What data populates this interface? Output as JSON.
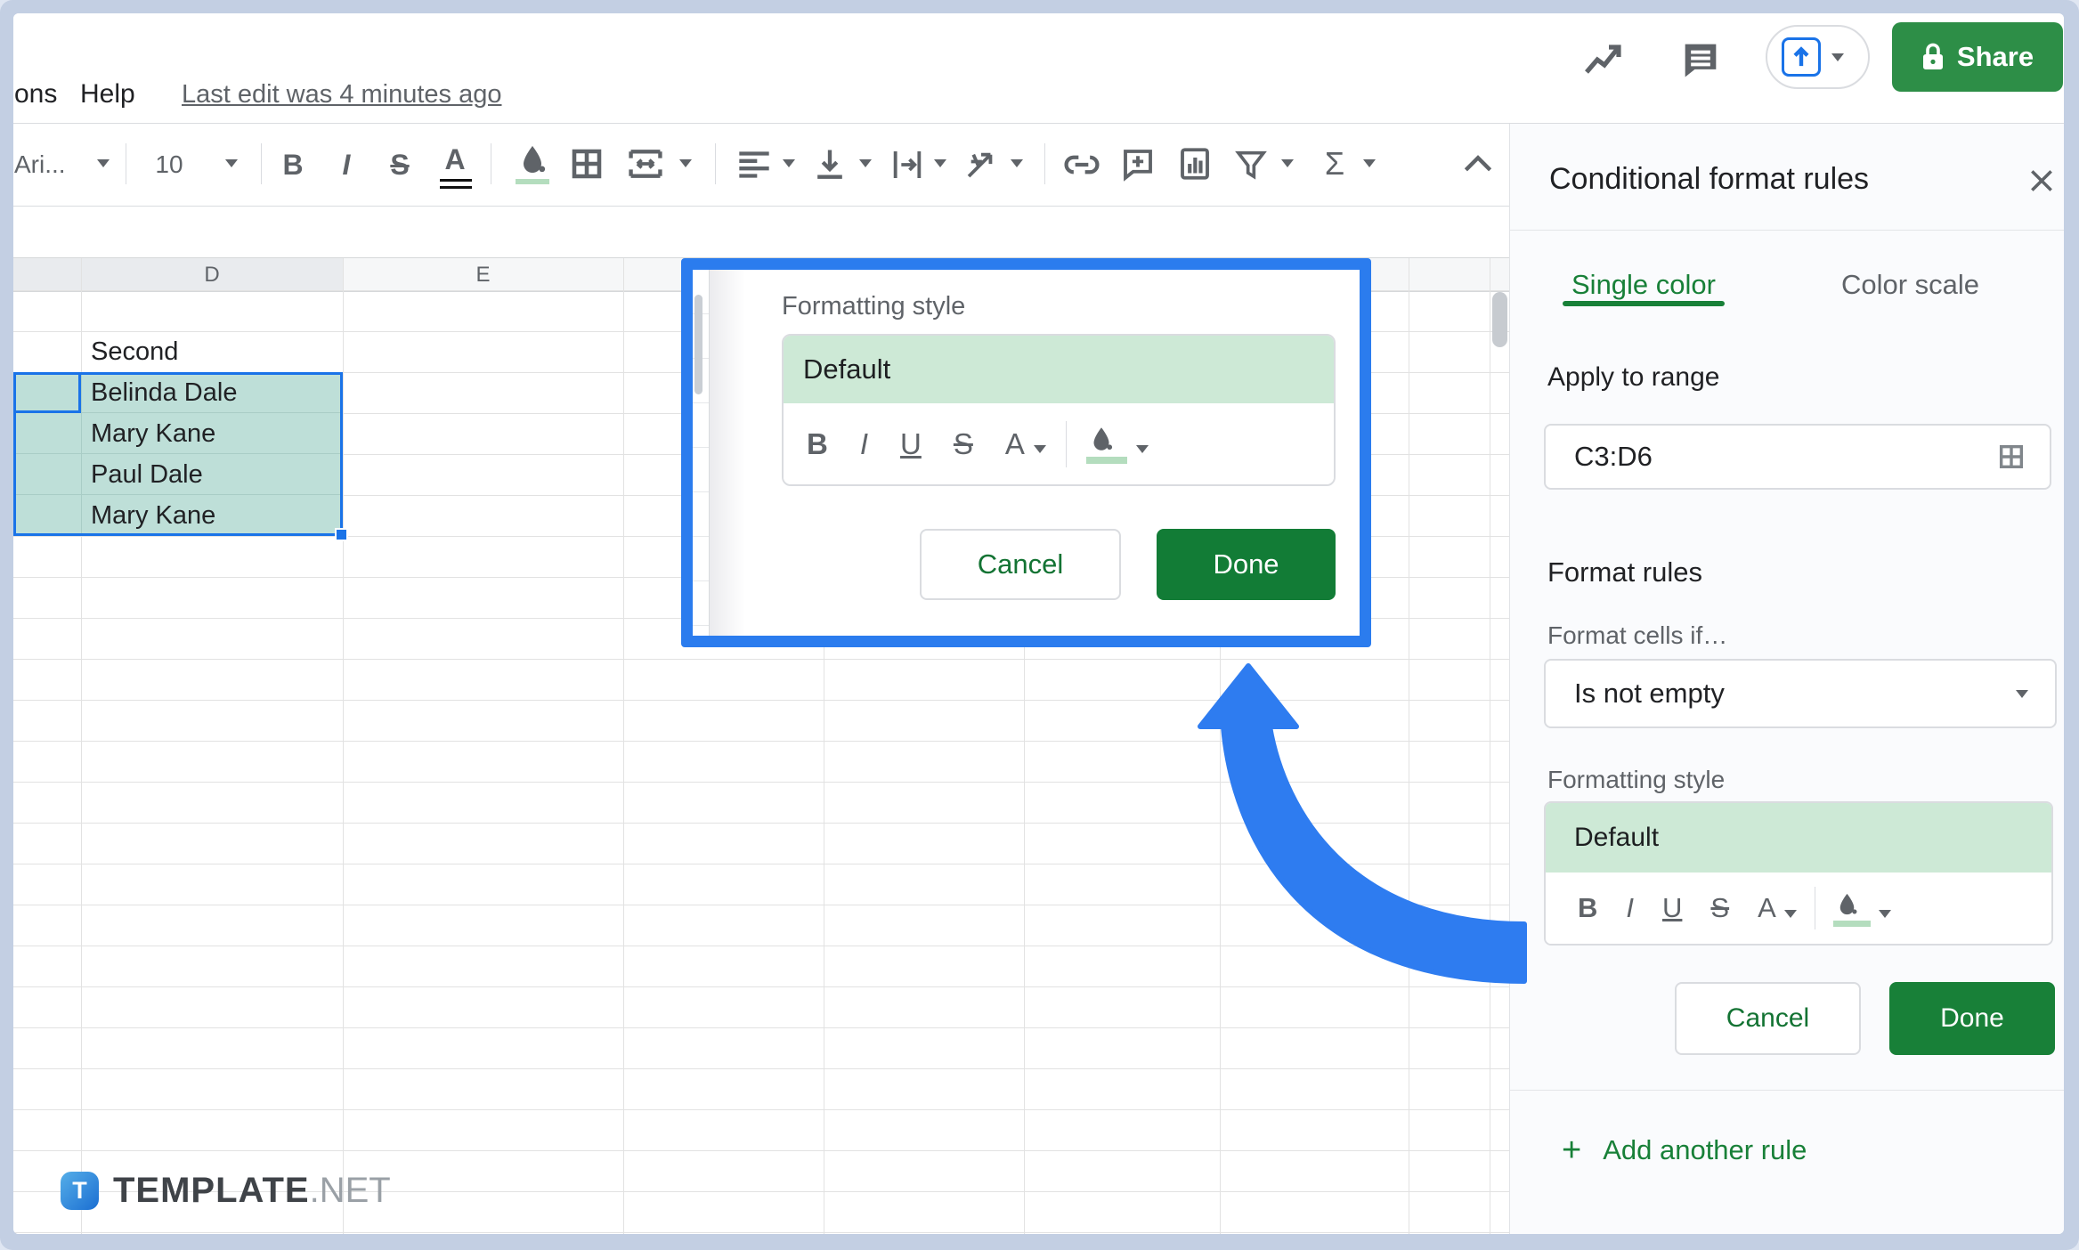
{
  "menu": {
    "items": [
      {
        "label": "ons"
      },
      {
        "label": "Help"
      }
    ],
    "last_edit": "Last edit was 4 minutes ago"
  },
  "topbar": {
    "share_label": "Share",
    "icons": [
      "trend-icon",
      "comment-history-icon",
      "present-button",
      "lock-icon"
    ]
  },
  "toolbar": {
    "font_name": "Ari...",
    "font_size": "10",
    "sigma": "Σ",
    "icons": [
      "bold",
      "italic",
      "strikethrough",
      "text-color",
      "fill-color",
      "borders",
      "merge-cells",
      "horizontal-align",
      "vertical-align",
      "text-wrap",
      "text-rotate",
      "insert-link",
      "add-comment",
      "insert-chart",
      "filter",
      "functions",
      "collapse-toolbar"
    ]
  },
  "format_icons": {
    "bold": "B",
    "italic": "I",
    "underline": "U",
    "strikethrough": "S",
    "text_color": "A"
  },
  "sheet": {
    "columns": [
      {
        "label": "D"
      },
      {
        "label": "E"
      }
    ],
    "rows": [
      {
        "label": "Second"
      },
      {
        "label": "Belinda Dale"
      },
      {
        "label": "Mary Kane"
      },
      {
        "label": "Paul Dale"
      },
      {
        "label": "Mary Kane"
      }
    ]
  },
  "callout": {
    "formatting_style_label": "Formatting style",
    "style_value": "Default",
    "cancel_label": "Cancel",
    "done_label": "Done"
  },
  "panel": {
    "title": "Conditional format rules",
    "tabs": [
      {
        "label": "Single color"
      },
      {
        "label": "Color scale"
      }
    ],
    "apply_to_range_label": "Apply to range",
    "range_value": "C3:D6",
    "format_rules_label": "Format rules",
    "format_cells_if_label": "Format cells if…",
    "condition_value": "Is not empty",
    "formatting_style_label": "Formatting style",
    "style_value": "Default",
    "cancel_label": "Cancel",
    "done_label": "Done",
    "add_rule_plus": "+",
    "add_rule_label": "Add another rule"
  },
  "watermark": {
    "badge_letter": "T",
    "brand_bold": "TEMPLATE",
    "brand_light": ".NET"
  },
  "colors": {
    "accent_blue": "#1a73e8",
    "arrow_blue": "#2e7cf0",
    "callout_border_blue": "#2b7cee",
    "green_dark": "#137333",
    "green_mid": "#188038",
    "share_green": "#2d8e47",
    "selection_cell_green": "#bedfd8",
    "style_preview_green": "#cde9d6",
    "frame_blue": "#c3cfe3"
  }
}
